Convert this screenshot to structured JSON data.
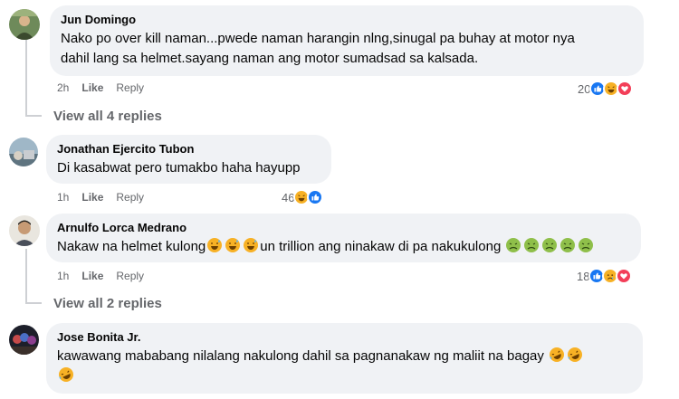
{
  "comments": [
    {
      "author": "Jun Domingo",
      "line1": "Nako po over kill naman...pwede naman harangin nlng,sinugal pa buhay at motor nya",
      "line2": "dahil lang sa helmet.sayang naman ang motor sumadsad sa kalsada.",
      "time": "2h",
      "like_label": "Like",
      "reply_label": "Reply",
      "reaction_count": "20",
      "reactions": [
        "like-icon",
        "haha-icon",
        "love-icon"
      ],
      "view_replies": "View all 4 replies"
    },
    {
      "author": "Jonathan Ejercito Tubon",
      "text": "Di kasabwat pero tumakbo haha hayupp",
      "time": "1h",
      "like_label": "Like",
      "reply_label": "Reply",
      "reaction_count": "46",
      "reactions": [
        "haha-icon",
        "like-icon"
      ]
    },
    {
      "author": "Arnulfo Lorca Medrano",
      "text_a": "Nakaw na helmet kulong",
      "text_b": "un trillion ang ninakaw di pa nakukulong",
      "emojis_a": [
        "grin-sweat-emoji",
        "grin-sweat-emoji",
        "grin-sweat-emoji"
      ],
      "emojis_b": [
        "nauseated-emoji",
        "nauseated-emoji",
        "nauseated-emoji",
        "nauseated-emoji",
        "nauseated-emoji"
      ],
      "time": "1h",
      "like_label": "Like",
      "reply_label": "Reply",
      "reaction_count": "18",
      "reactions": [
        "like-icon",
        "sad-icon",
        "love-icon"
      ],
      "view_replies": "View all 2 replies"
    },
    {
      "author": "Jose Bonita Jr.",
      "text": "kawawang mababang nilalang nakulong dahil sa pagnanakaw ng maliit na bagay",
      "emojis": [
        "rofl-emoji",
        "rofl-emoji",
        "rofl-emoji"
      ]
    }
  ],
  "colors": {
    "bubble": "#f0f2f5",
    "secondary_text": "#65676b",
    "like_blue": "#1877f2",
    "love_red": "#f33e58",
    "haha_yellow": "#f7b125"
  }
}
